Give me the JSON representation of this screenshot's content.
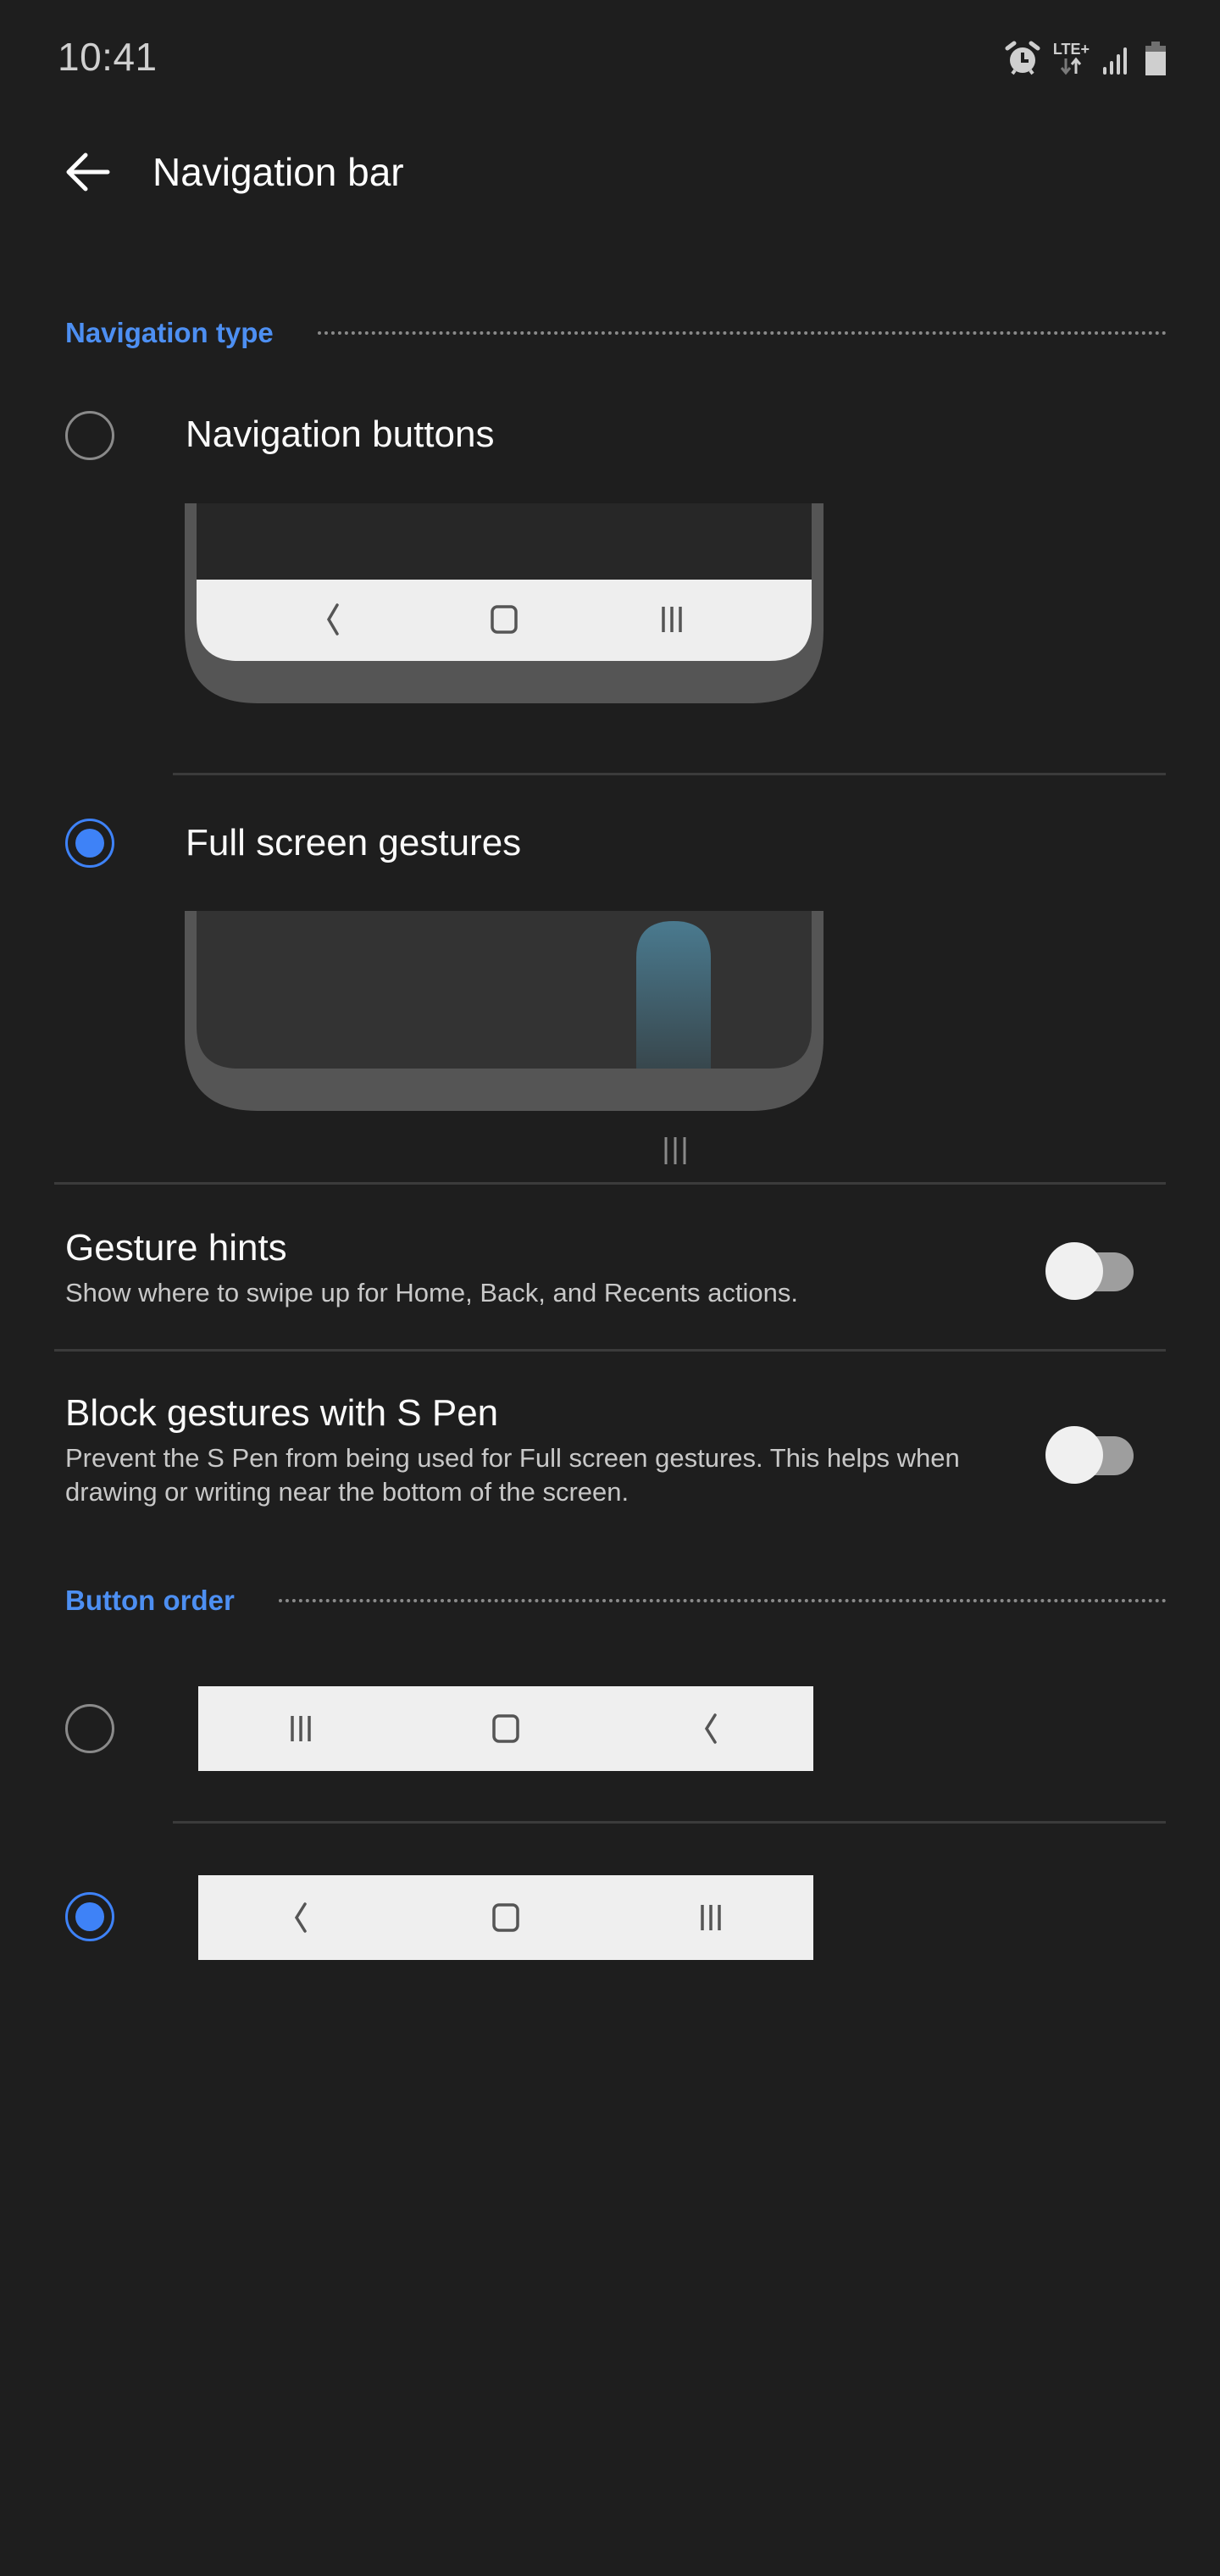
{
  "status_bar": {
    "time": "10:41",
    "icons": [
      "alarm-icon",
      "lte-plus-data-icon",
      "signal-icon",
      "battery-icon"
    ],
    "network_label": "LTE+"
  },
  "app_bar": {
    "back_icon": "arrow-left-icon",
    "title": "Navigation bar"
  },
  "navigation_type": {
    "header": "Navigation type",
    "options": [
      {
        "label": "Navigation buttons",
        "selected": false,
        "preview_buttons": [
          "back-icon",
          "home-icon",
          "recents-icon"
        ]
      },
      {
        "label": "Full screen gestures",
        "selected": true,
        "preview": "swipe-gesture"
      }
    ],
    "gesture_handle_icon": "recents-icon"
  },
  "settings": [
    {
      "title": "Gesture hints",
      "subtitle": "Show where to swipe up for Home, Back, and Recents actions.",
      "enabled": false
    },
    {
      "title": "Block gestures with S Pen",
      "subtitle": "Prevent the S Pen from being used for Full screen gestures. This helps when drawing or writing near the bottom of the screen.",
      "enabled": false
    }
  ],
  "button_order": {
    "header": "Button order",
    "options": [
      {
        "selected": false,
        "buttons": [
          "recents-icon",
          "home-icon",
          "back-icon"
        ]
      },
      {
        "selected": true,
        "buttons": [
          "back-icon",
          "home-icon",
          "recents-icon"
        ]
      }
    ]
  },
  "colors": {
    "accent": "#3e82f7",
    "section_header": "#4d8ff2",
    "background": "#1e1e1e",
    "gesture_highlight": "#4a7a8f"
  }
}
